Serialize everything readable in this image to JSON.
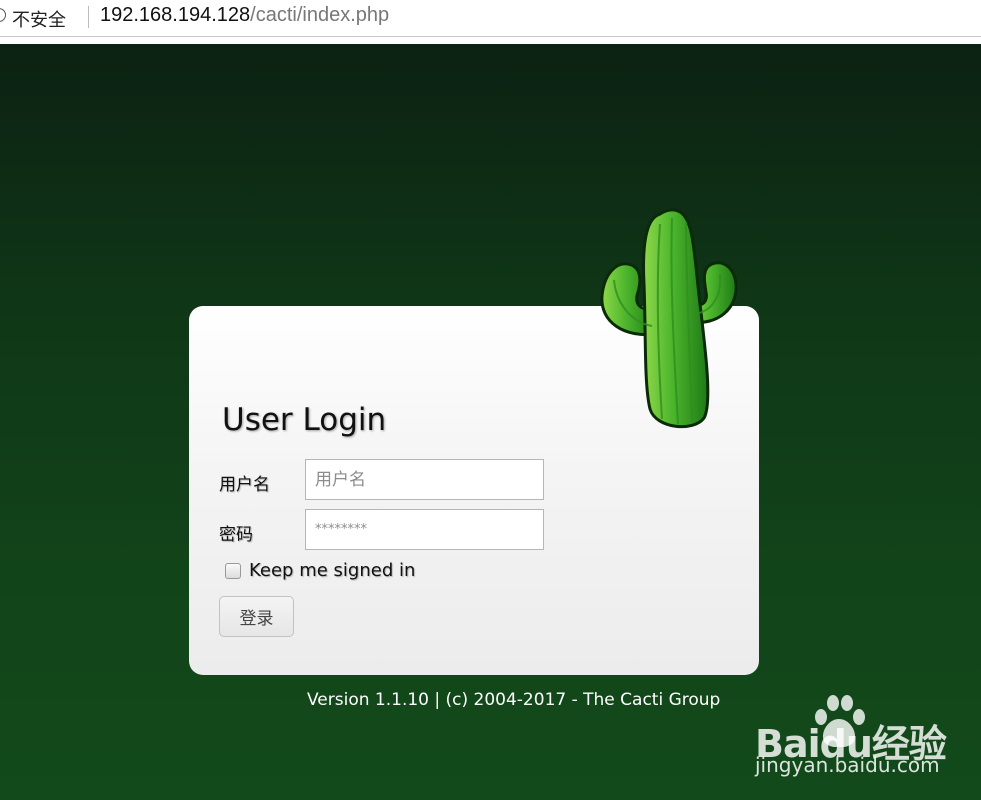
{
  "browser": {
    "security_label": "不安全",
    "url_host": "192.168.194.128",
    "url_path": "/cacti/index.php"
  },
  "login": {
    "title": "User Login",
    "username_label": "用户名",
    "username_placeholder": "用户名",
    "password_label": "密码",
    "password_placeholder": "********",
    "keep_signed_in_label": "Keep me signed in",
    "keep_signed_in_checked": false,
    "login_button_label": "登录"
  },
  "footer": {
    "version_text": "Version 1.1.10 | (c) 2004-2017 - The Cacti Group"
  },
  "logo": {
    "icon": "cactus-icon"
  },
  "watermark": {
    "logo_text": "Baidu经验",
    "site": "jingyan.baidu.com"
  },
  "colors": {
    "background_top": "#0c2112",
    "background_bottom": "#124a1b",
    "card": "#f2f2f2",
    "cactus_green": "#3fae2a"
  }
}
